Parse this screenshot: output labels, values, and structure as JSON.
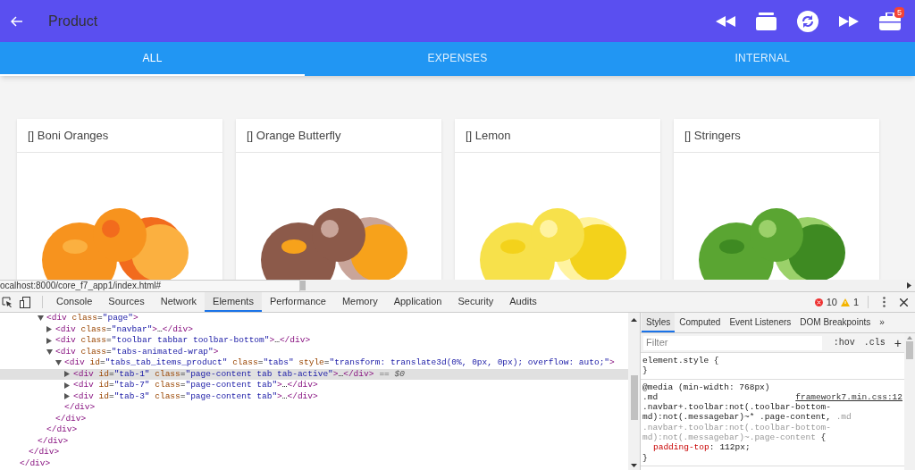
{
  "app_bar": {
    "title": "Product",
    "badge": "5"
  },
  "tabs": [
    {
      "label": "ALL",
      "selected": true
    },
    {
      "label": "EXPENSES",
      "selected": false
    },
    {
      "label": "INTERNAL",
      "selected": false
    }
  ],
  "products": [
    {
      "title": "[] Boni Oranges"
    },
    {
      "title": "[] Orange Butterfly"
    },
    {
      "title": "[] Lemon"
    },
    {
      "title": "[] Stringers"
    }
  ],
  "status_url": "ocalhost:8000/core_f7_app1/index.html#",
  "devtools": {
    "tabs": [
      {
        "label": "Console",
        "selected": false
      },
      {
        "label": "Sources",
        "selected": false
      },
      {
        "label": "Network",
        "selected": false
      },
      {
        "label": "Elements",
        "selected": true
      },
      {
        "label": "Performance",
        "selected": false
      },
      {
        "label": "Memory",
        "selected": false
      },
      {
        "label": "Application",
        "selected": false
      },
      {
        "label": "Security",
        "selected": false
      },
      {
        "label": "Audits",
        "selected": false
      }
    ],
    "errors": "10",
    "warnings": "1",
    "dom_tree": [
      {
        "close": "</div>",
        "children": [
          {
            "close": "</div>",
            "children": [
              {
                "close": "</div>",
                "children": [
                  {
                    "open": "<div class=\"page\">",
                    "expanded": true,
                    "close": "</div>",
                    "children": [
                      {
                        "open": "<div class=\"navbar\">…</div>",
                        "expanded": false
                      },
                      {
                        "open": "<div class=\"toolbar tabbar toolbar-bottom\">…</div>",
                        "expanded": false
                      },
                      {
                        "open": "<div class=\"tabs-animated-wrap\">",
                        "expanded": true,
                        "close": "</div>",
                        "children": [
                          {
                            "open": "<div id=\"tabs_tab_items_product\" class=\"tabs\" style=\"transform: translate3d(0%, 0px, 0px); overflow: auto;\">",
                            "expanded": true,
                            "close": "</div>",
                            "children": [
                              {
                                "open": "<div id=\"tab-1\" class=\"page-content tab tab-active\">…</div>",
                                "expanded": false,
                                "selected": true,
                                "console_ref": "== $0"
                              },
                              {
                                "open": "<div id=\"tab-7\" class=\"page-content tab\">…</div>",
                                "expanded": false,
                                "selected": false
                              },
                              {
                                "open": "<div id=\"tab-3\" class=\"page-content tab\">…</div>",
                                "expanded": false,
                                "selected": false
                              }
                            ]
                          }
                        ]
                      }
                    ]
                  }
                ]
              }
            ]
          }
        ]
      }
    ],
    "styles_tabs": [
      {
        "label": "Styles",
        "selected": true
      },
      {
        "label": "Computed",
        "selected": false
      },
      {
        "label": "Event Listeners",
        "selected": false
      },
      {
        "label": "DOM Breakpoints",
        "selected": false
      },
      {
        "label": "»",
        "selected": false
      }
    ],
    "filter_placeholder": "Filter",
    "hov": ":hov",
    "cls": ".cls",
    "add": "+",
    "rules": [
      {
        "lines": [
          [
            {
              "text": "element.style {",
              "matched": true
            }
          ],
          [
            {
              "text": "}",
              "matched": true
            }
          ]
        ]
      },
      {
        "source": "framework7.min.css:12",
        "lines": [
          [
            {
              "text": "@media (min-width: 768px)",
              "matched": true
            }
          ],
          [
            {
              "text": ".md",
              "matched": true
            }
          ],
          [
            {
              "text": ".navbar+.toolbar:not(.toolbar-bottom-",
              "matched": true
            }
          ],
          [
            {
              "text": "md):not(.messagebar)~* .page-content, ",
              "matched": true
            },
            {
              "text": ".md",
              "matched": false
            }
          ],
          [
            {
              "text": ".navbar+.toolbar:not(.toolbar-bottom-",
              "matched": false
            }
          ],
          [
            {
              "text": "md):not(.messagebar)~.page-content",
              "matched": false
            },
            {
              "text": " {",
              "matched": true
            }
          ]
        ],
        "declarations": [
          {
            "property": "padding-top",
            "separator": ":",
            "value": "112px;"
          }
        ],
        "end": "}"
      }
    ]
  }
}
